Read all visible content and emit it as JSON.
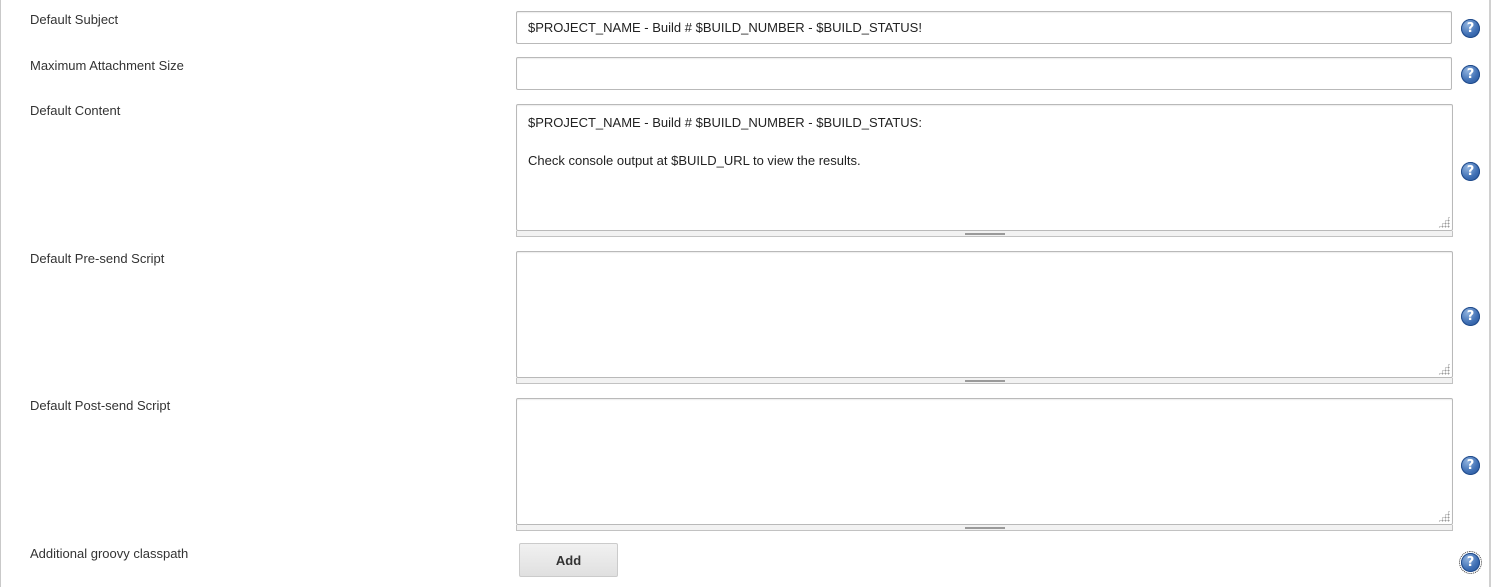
{
  "fields": {
    "default_subject": {
      "label": "Default Subject",
      "value": "$PROJECT_NAME - Build # $BUILD_NUMBER - $BUILD_STATUS!"
    },
    "max_attachment_size": {
      "label": "Maximum Attachment Size",
      "value": ""
    },
    "default_content": {
      "label": "Default Content",
      "value": "$PROJECT_NAME - Build # $BUILD_NUMBER - $BUILD_STATUS:\n\nCheck console output at $BUILD_URL to view the results."
    },
    "pre_send_script": {
      "label": "Default Pre-send Script",
      "value": ""
    },
    "post_send_script": {
      "label": "Default Post-send Script",
      "value": ""
    },
    "groovy_classpath": {
      "label": "Additional groovy classpath",
      "button_label": "Add"
    }
  },
  "icons": {
    "help": "question-mark-help-icon",
    "help_glyph": "?"
  },
  "colors": {
    "help_icon": "#3f6fb4",
    "input_border": "#b9b9b9",
    "button_bg": "#e8e8e8"
  }
}
